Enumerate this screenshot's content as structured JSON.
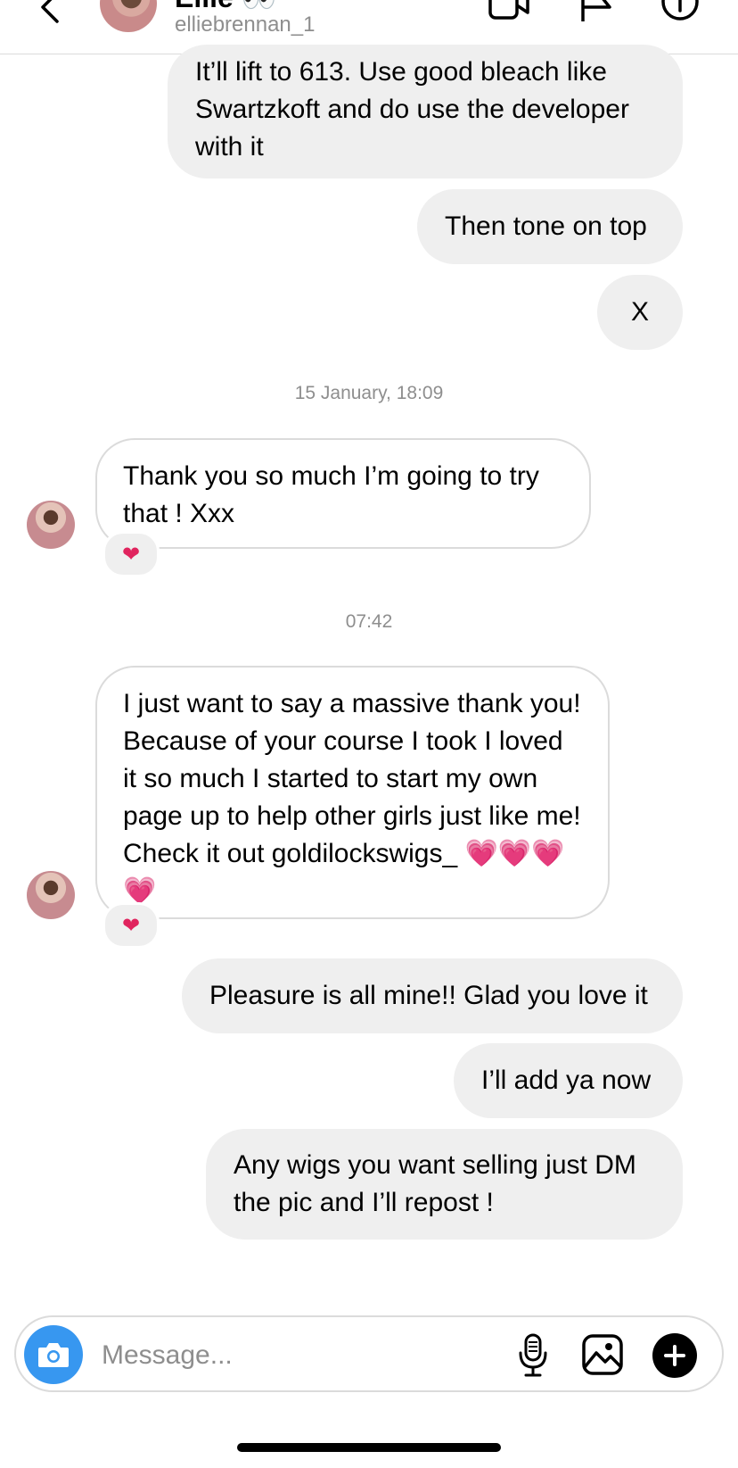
{
  "header": {
    "name": "Ellie 👀",
    "username": "elliebrennan_1"
  },
  "messages": {
    "m1": "It’ll lift to 613. Use good bleach like Swartzkoft and do use the developer with it",
    "m2": "Then tone on top",
    "m3": "X",
    "ts1": "15 January, 18:09",
    "m4": "Thank you so much I’m going to try that ! Xxx",
    "ts2": "07:42",
    "m5": "I just want to say a massive thank you! Because of your course I took I loved it so much I started to start my own page up to help other girls just like me! Check it out goldilockswigs_ 💗💗💗💗",
    "m6": "Pleasure is all mine!! Glad you love it",
    "m7": "I’ll add ya now",
    "m8": "Any wigs you want selling just DM the pic and I’ll repost !",
    "reaction": "❤"
  },
  "composer": {
    "placeholder": "Message..."
  },
  "colors": {
    "accent": "#3797f0",
    "outgoing_bubble": "#efefef",
    "incoming_border": "#dbdbdb",
    "reaction": "#e0245e"
  }
}
